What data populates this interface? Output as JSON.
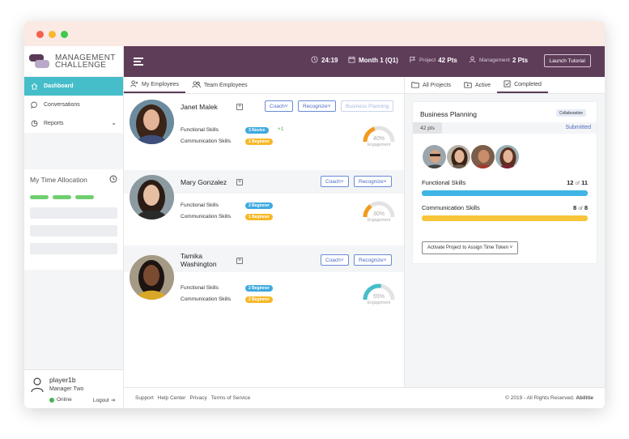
{
  "app": {
    "logo_line1": "MANAGEMENT",
    "logo_line2": "CHALLENGE"
  },
  "sidebar": {
    "items": [
      {
        "label": "Dashboard",
        "icon": "home-icon",
        "active": true
      },
      {
        "label": "Conversations",
        "icon": "chat-icon"
      },
      {
        "label": "Reports",
        "icon": "pie-chart-icon"
      }
    ],
    "time_allocation_title": "My Time Allocation"
  },
  "profile": {
    "username": "player1b",
    "role": "Manager Two",
    "status": "Online",
    "logout_label": "Logout"
  },
  "topbar": {
    "time": "24:19",
    "month": "Month 1 (Q1)",
    "project_label": "Project",
    "project_pts": "42 Pts",
    "management_label": "Management",
    "management_pts": "2 Pts",
    "tutorial_label": "Launch Tutorial"
  },
  "employee_tabs": [
    {
      "label": "My Employees",
      "active": true
    },
    {
      "label": "Team Employees"
    }
  ],
  "employees": [
    {
      "name": "Janet Malek",
      "coach_label": "Coach",
      "recognize_label": "Recognize",
      "assignment_label": "Business Planning",
      "skills": [
        {
          "label": "Functional Skills",
          "badge": "3 Novice",
          "badge_color": "#3fa9e0",
          "delta": "+1"
        },
        {
          "label": "Communication Skills",
          "badge": "1 Beginner",
          "badge_color": "#f6b828"
        }
      ],
      "engagement_pct": "40%",
      "engagement_value": 40,
      "engagement_color": "#f39a1f",
      "engagement_label": "Engagement"
    },
    {
      "name": "Mary Gonzalez",
      "coach_label": "Coach",
      "recognize_label": "Recognize",
      "skills": [
        {
          "label": "Functional Skills",
          "badge": "2 Beginner",
          "badge_color": "#3fa9e0"
        },
        {
          "label": "Communication Skills",
          "badge": "1 Beginner",
          "badge_color": "#f6b828"
        }
      ],
      "engagement_pct": "30%",
      "engagement_value": 30,
      "engagement_color": "#f39a1f",
      "engagement_label": "Engagement"
    },
    {
      "name": "Tamika Washington",
      "name_line1": "Tamika",
      "name_line2": "Washington",
      "coach_label": "Coach",
      "recognize_label": "Recognize",
      "skills": [
        {
          "label": "Functional Skills",
          "badge": "2 Beginner",
          "badge_color": "#3fa9e0"
        },
        {
          "label": "Communication Skills",
          "badge": "2 Beginner",
          "badge_color": "#f6b828"
        }
      ],
      "engagement_pct": "55%",
      "engagement_value": 55,
      "engagement_color": "#45bec9",
      "engagement_label": "Engagement"
    }
  ],
  "project_tabs": [
    {
      "label": "All Projects"
    },
    {
      "label": "Active"
    },
    {
      "label": "Completed",
      "active": true
    }
  ],
  "project": {
    "title": "Business Planning",
    "tag": "Collaborative",
    "points": "42 pts",
    "status": "Submitted",
    "skills": [
      {
        "label": "Functional Skills",
        "current": "12",
        "of": "of",
        "total": "11",
        "color": "#3fb5e5"
      },
      {
        "label": "Communication Skills",
        "current": "8",
        "of": "of",
        "total": "8",
        "color": "#f8c53a"
      }
    ],
    "activate_label": "Activate Project to Assign Time Token"
  },
  "footer": {
    "links": [
      "Support",
      "Help Center",
      "Privacy",
      "Terms of Service"
    ],
    "copyright": "© 2019 - All Rights Reserved.",
    "brand": "Abilitie"
  },
  "colors": {
    "topbar": "#5e3d59",
    "active_nav": "#45bec9",
    "accent_link": "#4b6cc1"
  }
}
